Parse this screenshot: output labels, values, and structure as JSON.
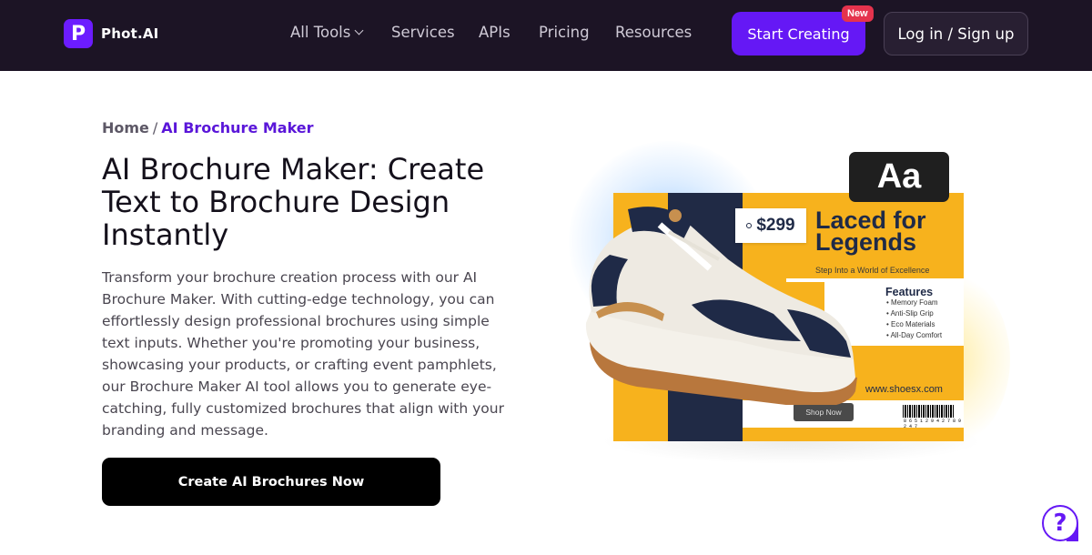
{
  "brand": {
    "logo_letter": "P",
    "name": "Phot.AI",
    "accent": "#6518f5"
  },
  "nav": {
    "items": [
      {
        "label": "All Tools"
      },
      {
        "label": "Services"
      },
      {
        "label": "APIs"
      },
      {
        "label": "Pricing"
      },
      {
        "label": "Resources"
      }
    ],
    "start_label": "Start Creating",
    "new_badge": "New",
    "login_label": "Log in / Sign up"
  },
  "breadcrumb": {
    "home": "Home",
    "separator": "/",
    "current": "AI Brochure Maker"
  },
  "main": {
    "title": "AI Brochure Maker: Create Text to Brochure Design Instantly",
    "description": "Transform your brochure creation process with our AI Brochure Maker. With cutting-edge technology, you can effortlessly design professional brochures using simple text inputs. Whether you're promoting your business, showcasing your products, or crafting event pamphlets, our Brochure Maker AI tool allows you to generate eye-catching, fully customized brochures that align with your branding and message.",
    "cta_label": "Create AI Brochures Now"
  },
  "hero": {
    "aa": "Aa",
    "price": "$299",
    "headline_line1": "Laced for",
    "headline_line2": "Legends",
    "tagline": "Step Into a World of Excellence",
    "features_title": "Features",
    "features": [
      "Memory Foam",
      "Anti-Slip Grip",
      "Eco Materials",
      "All-Day Comfort"
    ],
    "website": "www.shoesx.com",
    "shop_now": "Shop Now",
    "barcode_number": "8 6 5 1 2 9 4 2 7 8 9 2 4 7"
  },
  "help": {
    "icon": "question-icon",
    "symbol": "?"
  }
}
